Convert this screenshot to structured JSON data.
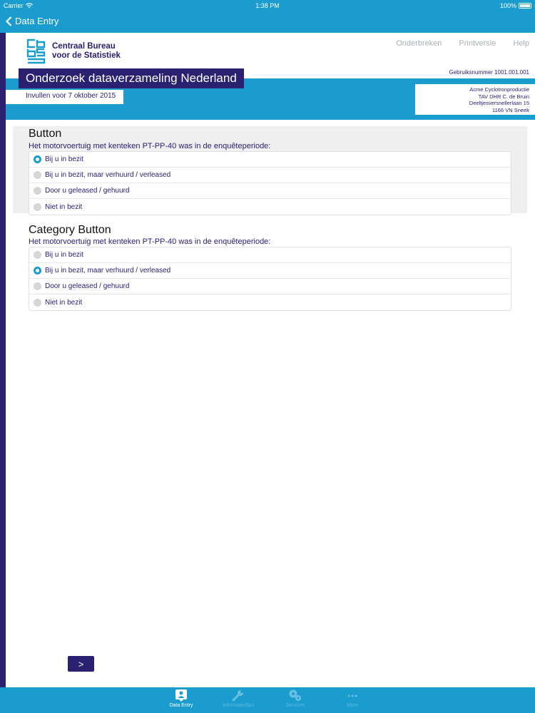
{
  "status_bar": {
    "carrier": "Carrier",
    "time": "1:38 PM",
    "battery": "100%"
  },
  "nav": {
    "back_label": "Data Entry"
  },
  "logo": {
    "line1": "Centraal Bureau",
    "line2": "voor de Statistiek",
    "mark": "cbs"
  },
  "links": [
    "Onderbreken",
    "Printversie",
    "Help"
  ],
  "user_number": "Gebruiksnummer 1001.001.001",
  "survey_title": "Onderzoek dataverzameling Nederland",
  "deadline": "Invullen voor 7 oktober 2015",
  "address": [
    "Acme Cyclotronproductie",
    "TAV DHR C. de Bruin",
    "Deeltjesversnellerlaan 15",
    "1166 VN Sneek"
  ],
  "sections": [
    {
      "title": "Button",
      "question": "Het motorvoertuig met kenteken PT-PP-40 was in de enquêteperiode:",
      "options": [
        "Bij u in bezit",
        "Bij u in bezit, maar verhuurd / verleased",
        "Door u geleased / gehuurd",
        "Niet in bezit"
      ],
      "selected": 0
    },
    {
      "title": "Category Button",
      "question": "Het motorvoertuig met kenteken PT-PP-40 was in de enquêteperiode:",
      "options": [
        "Bij u in bezit",
        "Bij u in bezit, maar verhuurd / verleased",
        "Door u geleased / gehuurd",
        "Niet in bezit"
      ],
      "selected": 1
    }
  ],
  "next_label": ">",
  "tabs": [
    {
      "label": "Data Entry",
      "icon": "data-entry-icon",
      "active": true
    },
    {
      "label": "Informatie/tips",
      "icon": "wrench-icon",
      "active": false
    },
    {
      "label": "Services",
      "icon": "gears-icon",
      "active": false
    },
    {
      "label": "More",
      "icon": "more-icon",
      "active": false
    }
  ],
  "colors": {
    "primary_blue": "#1a9ccf",
    "navy": "#2b2170",
    "gray_section": "#efefef"
  }
}
